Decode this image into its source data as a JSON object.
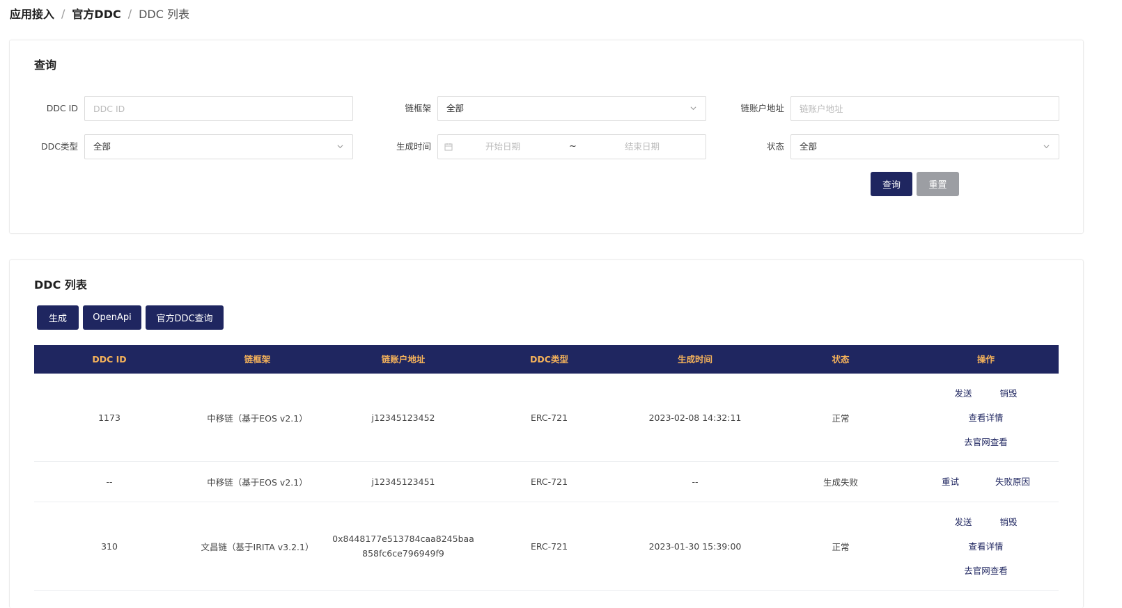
{
  "breadcrumb": [
    "应用接入",
    "官方DDC",
    "DDC 列表"
  ],
  "query": {
    "title": "查询",
    "fields": {
      "ddc_id": {
        "label": "DDC ID",
        "placeholder": "DDC ID"
      },
      "chain_framework": {
        "label": "链框架",
        "value": "全部"
      },
      "chain_account": {
        "label": "链账户地址",
        "placeholder": "链账户地址"
      },
      "ddc_type": {
        "label": "DDC类型",
        "value": "全部"
      },
      "created_time": {
        "label": "生成时间",
        "start_placeholder": "开始日期",
        "separator": "~",
        "end_placeholder": "结束日期"
      },
      "status": {
        "label": "状态",
        "value": "全部"
      }
    },
    "buttons": {
      "query": "查询",
      "reset": "重置"
    }
  },
  "list": {
    "title": "DDC 列表",
    "buttons": {
      "generate": "生成",
      "openapi": "OpenApi",
      "official_query": "官方DDC查询"
    },
    "columns": [
      "DDC ID",
      "链框架",
      "链账户地址",
      "DDC类型",
      "生成时间",
      "状态",
      "操作"
    ],
    "rows": [
      {
        "ddc_id": "1173",
        "framework": "中移链（基于EOS v2.1）",
        "address": [
          "j12345123452"
        ],
        "type": "ERC-721",
        "time": "2023-02-08 14:32:11",
        "status": "正常",
        "ops": {
          "send": "发送",
          "destroy": "销毁",
          "detail": "查看详情",
          "official": "去官网查看"
        }
      },
      {
        "ddc_id": "--",
        "framework": "中移链（基于EOS v2.1）",
        "address": [
          "j12345123451"
        ],
        "type": "ERC-721",
        "time": "--",
        "status": "生成失败",
        "ops": {
          "retry": "重试",
          "reason": "失败原因"
        }
      },
      {
        "ddc_id": "310",
        "framework": "文昌链（基于IRITA v3.2.1）",
        "address": [
          "0x8448177e513784caa8245baa",
          "858fc6ce796949f9"
        ],
        "type": "ERC-721",
        "time": "2023-01-30 15:39:00",
        "status": "正常",
        "ops": {
          "send": "发送",
          "destroy": "销毁",
          "detail": "查看详情",
          "official": "去官网查看"
        }
      }
    ]
  },
  "colors": {
    "primary": "#1f2660",
    "header_text": "#f6b35a",
    "reset_button": "#9c9ea3"
  },
  "icons": {
    "select_arrow": "chevron-down-icon",
    "date": "calendar-icon"
  }
}
